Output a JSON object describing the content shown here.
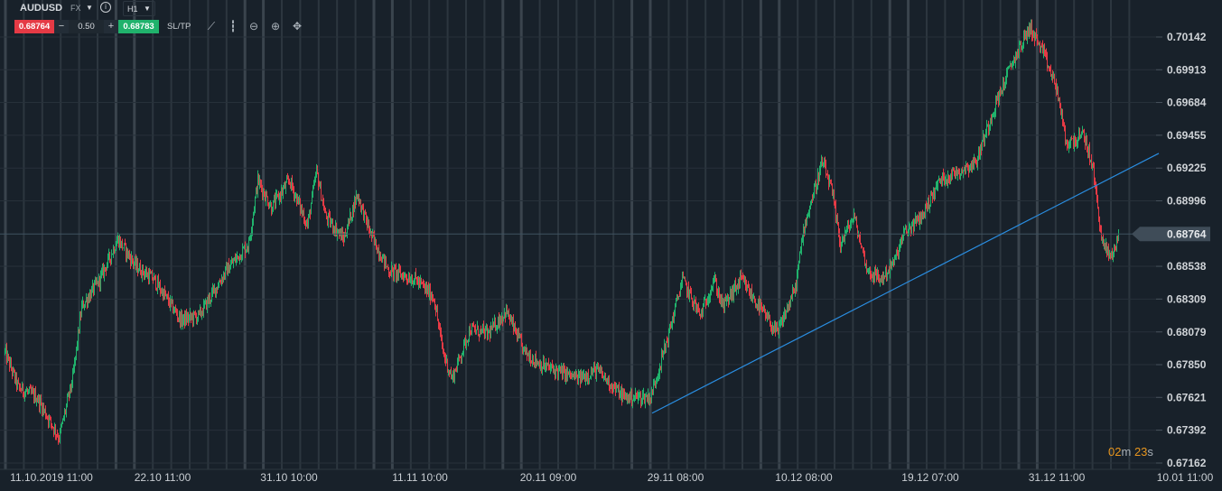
{
  "toolbar": {
    "symbol": "AUDUSD",
    "market": "FX",
    "timeframe": "H1",
    "info_icon": "i",
    "bid": "0.68764",
    "lot": "0.50",
    "ask": "0.68783",
    "minus": "−",
    "plus": "+",
    "sltp": "SL/TP",
    "tools": [
      "line-chart-icon",
      "candles-icon",
      "zoom-out-icon",
      "zoom-in-icon",
      "crosshair-icon"
    ]
  },
  "countdown": {
    "min": "02",
    "min_unit": "m",
    "sec": "23",
    "sec_unit": "s"
  },
  "colors": {
    "background": "#18212a",
    "up": "#20b26c",
    "down": "#e53a45",
    "trendline": "#2a8de0",
    "grid": "#2c363f",
    "countdown": "#e8961e"
  },
  "chart_data": {
    "type": "candlestick",
    "symbol": "AUDUSD",
    "interval": "H1",
    "ylim": [
      0.67162,
      0.70142
    ],
    "y_ticks": [
      "0.70142",
      "0.69913",
      "0.69684",
      "0.69455",
      "0.69225",
      "0.68996",
      "0.68538",
      "0.68309",
      "0.68079",
      "0.67850",
      "0.67621",
      "0.67392",
      "0.67162"
    ],
    "x_ticks": [
      "11.10.2019 11:00",
      "22.10 11:00",
      "31.10 10:00",
      "11.11 10:00",
      "20.11 09:00",
      "29.11 08:00",
      "10.12 08:00",
      "19.12 07:00",
      "31.12 11:00",
      "10.01 11:00"
    ],
    "x_tick_bars": [
      52,
      175,
      315,
      460,
      602,
      743,
      885,
      1025,
      1165,
      1307
    ],
    "current_price": "0.68764",
    "price_path": [
      [
        0,
        0.6794
      ],
      [
        15,
        0.67687
      ],
      [
        35,
        0.67624
      ],
      [
        60,
        0.6734
      ],
      [
        75,
        0.67751
      ],
      [
        85,
        0.68255
      ],
      [
        105,
        0.68445
      ],
      [
        125,
        0.68729
      ],
      [
        145,
        0.68539
      ],
      [
        165,
        0.68445
      ],
      [
        195,
        0.68161
      ],
      [
        215,
        0.68192
      ],
      [
        245,
        0.68508
      ],
      [
        270,
        0.68697
      ],
      [
        280,
        0.69139
      ],
      [
        295,
        0.68949
      ],
      [
        315,
        0.69139
      ],
      [
        335,
        0.68823
      ],
      [
        345,
        0.69202
      ],
      [
        355,
        0.68886
      ],
      [
        375,
        0.68729
      ],
      [
        390,
        0.69044
      ],
      [
        405,
        0.6876
      ],
      [
        425,
        0.68508
      ],
      [
        455,
        0.68445
      ],
      [
        475,
        0.68318
      ],
      [
        485,
        0.6794
      ],
      [
        495,
        0.67751
      ],
      [
        515,
        0.68098
      ],
      [
        535,
        0.68066
      ],
      [
        555,
        0.68224
      ],
      [
        575,
        0.6794
      ],
      [
        595,
        0.67845
      ],
      [
        635,
        0.67751
      ],
      [
        655,
        0.67814
      ],
      [
        685,
        0.67624
      ],
      [
        715,
        0.67624
      ],
      [
        735,
        0.68066
      ],
      [
        750,
        0.68445
      ],
      [
        770,
        0.68192
      ],
      [
        785,
        0.68445
      ],
      [
        795,
        0.68255
      ],
      [
        815,
        0.68445
      ],
      [
        835,
        0.68255
      ],
      [
        855,
        0.68066
      ],
      [
        875,
        0.68382
      ],
      [
        885,
        0.68823
      ],
      [
        905,
        0.69265
      ],
      [
        915,
        0.69076
      ],
      [
        925,
        0.68697
      ],
      [
        940,
        0.68886
      ],
      [
        955,
        0.68508
      ],
      [
        970,
        0.68445
      ],
      [
        985,
        0.68571
      ],
      [
        995,
        0.6876
      ],
      [
        1015,
        0.68886
      ],
      [
        1035,
        0.69139
      ],
      [
        1055,
        0.69202
      ],
      [
        1075,
        0.69265
      ],
      [
        1095,
        0.69644
      ],
      [
        1115,
        0.69959
      ],
      [
        1135,
        0.70211
      ],
      [
        1150,
        0.70022
      ],
      [
        1165,
        0.6977
      ],
      [
        1175,
        0.69391
      ],
      [
        1195,
        0.69454
      ],
      [
        1205,
        0.69202
      ],
      [
        1215,
        0.68697
      ],
      [
        1225,
        0.68602
      ],
      [
        1233,
        0.68764
      ]
    ],
    "trendline": {
      "from": [
        717,
        0.67511
      ],
      "to": [
        1278,
        0.69328
      ]
    }
  }
}
